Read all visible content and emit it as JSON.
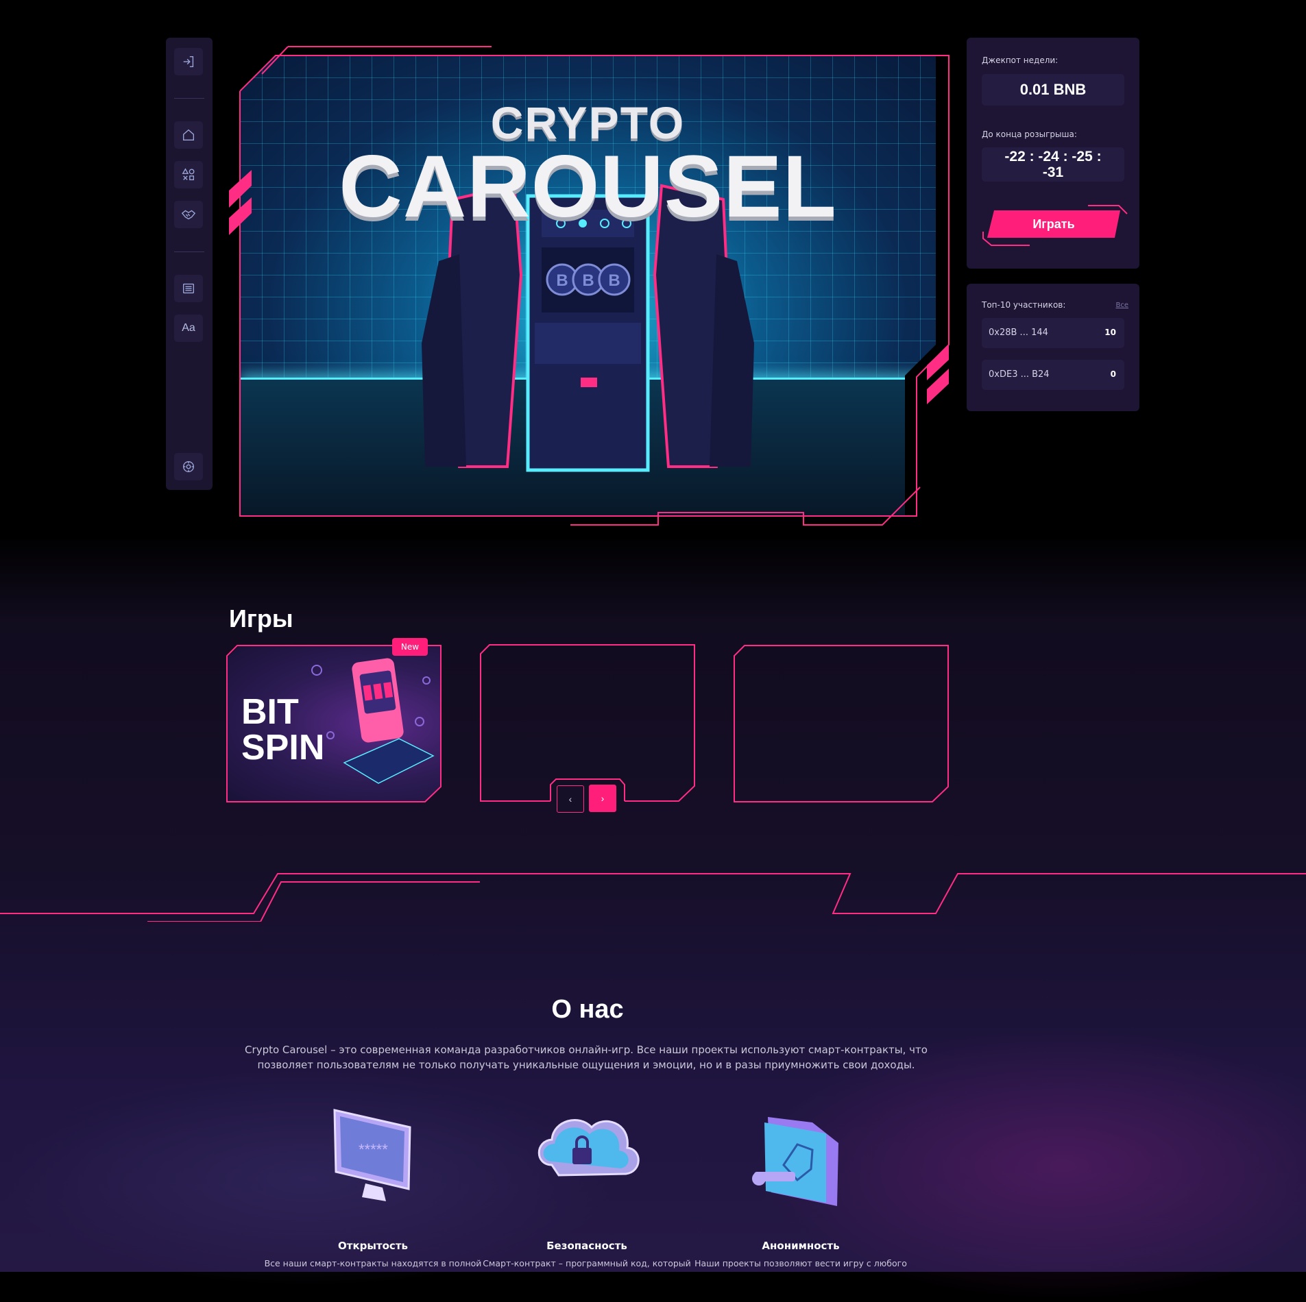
{
  "hero": {
    "title_top": "CRYPTO",
    "title_main": "CAROUSEL"
  },
  "sidebar": {
    "items": [
      {
        "icon": "login-icon"
      },
      {
        "icon": "home-icon"
      },
      {
        "icon": "games-icon"
      },
      {
        "icon": "handshake-icon"
      },
      {
        "icon": "list-icon"
      },
      {
        "label": "Aa"
      },
      {
        "icon": "settings-icon"
      }
    ]
  },
  "jackpot": {
    "label": "Джекпот недели:",
    "amount": "0.01 BNB",
    "countdown_label": "До конца розыгрыша:",
    "countdown_line1": "-22 : -24 : -25 :",
    "countdown_line2": "-31",
    "play_label": "Играть"
  },
  "top10": {
    "label": "Топ-10 участников:",
    "all_link": "Все",
    "rows": [
      {
        "address": "0x28B ... 144",
        "score": "10"
      },
      {
        "address": "0xDE3 ... B24",
        "score": "0"
      }
    ]
  },
  "games": {
    "title": "Игры",
    "cards": [
      {
        "title_line1": "BIT",
        "title_line2": "SPIN",
        "badge": "New"
      },
      {},
      {}
    ],
    "prev": "‹",
    "next": "›"
  },
  "about": {
    "title": "О нас",
    "description": "Crypto Carousel – это современная команда разработчиков онлайн-игр. Все наши проекты используют смарт-контракты, что позволяет пользователям не только получать уникальные ощущения и эмоции, но и в разы приумножить свои доходы.",
    "features": [
      {
        "title": "Открытость",
        "text": "Все наши смарт-контракты находятся в полной"
      },
      {
        "title": "Безопасность",
        "text": "Смарт-контракт – программный код, который"
      },
      {
        "title": "Анонимность",
        "text": "Наши проекты позволяют вести игру с любого"
      }
    ]
  },
  "colors": {
    "accent": "#ff1f7a",
    "neon_cyan": "#58ecff",
    "panel": "#1d1533"
  }
}
